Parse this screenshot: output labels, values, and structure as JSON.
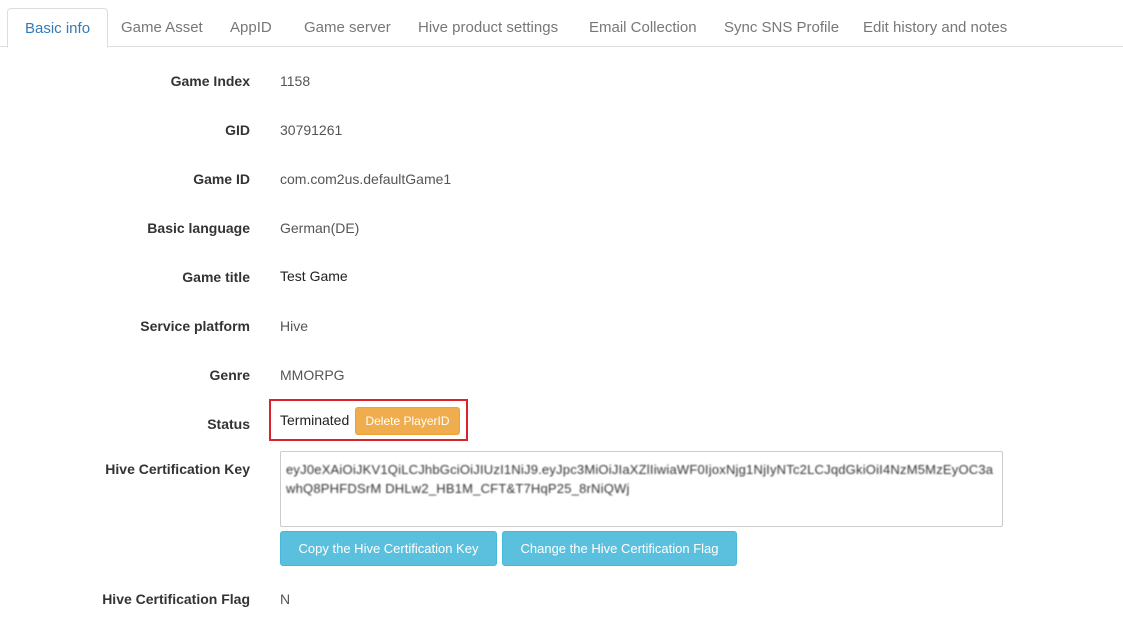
{
  "tabs": [
    {
      "label": "Basic info"
    },
    {
      "label": "Game Asset"
    },
    {
      "label": "AppID"
    },
    {
      "label": "Game server"
    },
    {
      "label": "Hive product settings"
    },
    {
      "label": "Email Collection"
    },
    {
      "label": "Sync SNS Profile"
    },
    {
      "label": "Edit history and notes"
    }
  ],
  "fields": {
    "game_index": {
      "label": "Game Index",
      "value": "1158"
    },
    "gid": {
      "label": "GID",
      "value": "30791261"
    },
    "game_id": {
      "label": "Game ID",
      "value": "com.com2us.defaultGame1"
    },
    "basic_language": {
      "label": "Basic language",
      "value": "German(DE)"
    },
    "game_title": {
      "label": "Game title",
      "value": "Test Game"
    },
    "service_platform": {
      "label": "Service platform",
      "value": "Hive"
    },
    "genre": {
      "label": "Genre",
      "value": "MMORPG"
    },
    "status": {
      "label": "Status",
      "value": "Terminated",
      "delete_button": "Delete PlayerID"
    },
    "cert_key": {
      "label": "Hive Certification Key",
      "value": "eyJ0eXAiOiJKV1QiLCJhbGciOiJIUzI1NiJ9.eyJpc3MiOiJIaXZlIiwiaWF0IjoxNjg1NjIyNTc2LCJqdGkiOiI4NzM5MzEyOC3a whQ8PHFDSrM DHLw2_HB1M_CFT&T7HqP25_8rNiQWj",
      "copy_button": "Copy the Hive Certification Key",
      "change_button": "Change the Hive Certification Flag"
    },
    "cert_flag": {
      "label": "Hive Certification Flag",
      "value": "N"
    }
  },
  "colors": {
    "tab_active": "#337ab7",
    "button_orange": "#f0ad4e",
    "button_blue": "#5bc0de",
    "highlight_border": "#d9232d"
  }
}
